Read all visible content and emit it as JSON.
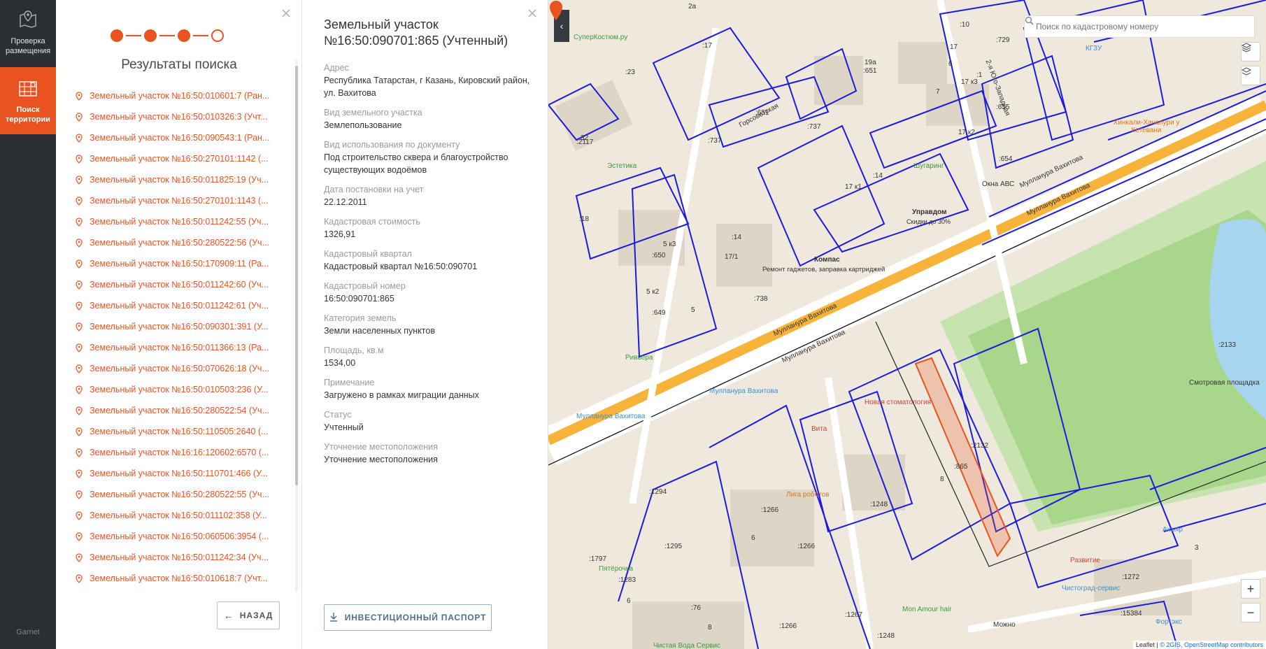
{
  "nav": {
    "items": [
      {
        "label": "Проверка размещения",
        "icon": "map-pin-icon"
      },
      {
        "label": "Поиск территории",
        "icon": "map-grid-icon"
      }
    ],
    "footer": "Garnet"
  },
  "results": {
    "title": "Результаты поиска",
    "steps": {
      "total": 4,
      "completed": 3
    },
    "items": [
      "Земельный участок №16:50:010601:7 (Ран...",
      "Земельный участок №16:50:010326:3 (Учт...",
      "Земельный участок №16:50:090543:1 (Ран...",
      "Земельный участок №16:50:270101:1142 (...",
      "Земельный участок №16:50:011825:19 (Уч...",
      "Земельный участок №16:50:270101:1143 (...",
      "Земельный участок №16:50:011242:55 (Уч...",
      "Земельный участок №16:50:280522:56 (Уч...",
      "Земельный участок №16:50:170909:11 (Ра...",
      "Земельный участок №16:50:011242:60 (Уч...",
      "Земельный участок №16:50:011242:61 (Уч...",
      "Земельный участок №16:50:090301:391 (У...",
      "Земельный участок №16:50:011366:13 (Ра...",
      "Земельный участок №16:50:070626:18 (Уч...",
      "Земельный участок №16:50:010503:236 (У...",
      "Земельный участок №16:50:280522:54 (Уч...",
      "Земельный участок №16:50:110505:2640 (...",
      "Земельный участок №16:16:120602:6570 (...",
      "Земельный участок №16:50:110701:466 (У...",
      "Земельный участок №16:50:280522:55 (Уч...",
      "Земельный участок №16:50:011102:358 (У...",
      "Земельный участок №16:50:060506:3954 (...",
      "Земельный участок №16:50:011242:34 (Уч...",
      "Земельный участок №16:50:010618:7 (Учт..."
    ],
    "back_label": "НАЗАД"
  },
  "details": {
    "title": "Земельный участок №16:50:090701:865 (Учтенный)",
    "fields": [
      {
        "label": "Адрес",
        "value": "Республика Татарстан, г Казань, Кировский район, ул. Вахитова"
      },
      {
        "label": "Вид земельного участка",
        "value": "Землепользование"
      },
      {
        "label": "Вид использования по документу",
        "value": "Под строительство сквера и благоустройство существующих водоёмов"
      },
      {
        "label": "Дата постановки на учет",
        "value": "22.12.2011"
      },
      {
        "label": "Кадастровая стоимость",
        "value": "1326,91"
      },
      {
        "label": "Кадастровый квартал",
        "value": "Кадастровый квартал №16:50:090701"
      },
      {
        "label": "Кадастровый номер",
        "value": "16:50:090701:865"
      },
      {
        "label": "Категория земель",
        "value": "Земли населенных пунктов"
      },
      {
        "label": "Площадь, кв.м",
        "value": "1534,00"
      },
      {
        "label": "Примечание",
        "value": "Загружено в рамках миграции данных"
      },
      {
        "label": "Статус",
        "value": "Учтенный"
      },
      {
        "label": "Уточнение местоположения",
        "value": "Уточнение местоположения"
      }
    ],
    "passport_label": "ИНВЕСТИЦИОННЫЙ ПАСПОРТ"
  },
  "map": {
    "search_placeholder": "Поиск по кадастровому номеру",
    "zoom_in": "+",
    "zoom_out": "−",
    "attribution_prefix": "Leaflet |",
    "attribution_main": "© 2GIS, OpenStreetMap contributors",
    "labels": {
      "suitcostume": "СуперКостюм.ру",
      "kgzu": "КГЗУ",
      "gorsovetskaya": "Горсоветская",
      "yugozapadnaya": "2-я Юго-Западная",
      "khinkali": "Хинкали-Хачапури у Кетевани",
      "estetika": "Эстетика",
      "shugaring": "Шугаринг",
      "oknaabc": "Окна АВС",
      "upravdom": "Управдом",
      "upravdom_sub": "Скидки до 30%",
      "kompas": "Компас",
      "kompas_sub": "Ремонт гаджетов, заправка картриджей",
      "vakhitova1": "Мулланура Вахитова",
      "vakhitova2": "Мулланура Вахитова",
      "vakhitova3": "Мулланура Вахитова",
      "vakhitova4": "Мулланура Вахитова",
      "vakhitova_stop1": "Мулланура Вахитова",
      "vakhitova_stop2": "Мулланура Вахитова",
      "riviera": "Ривьера",
      "stomatologia": "Новая стоматология",
      "vita": "Вита",
      "liga": "Лига роботов",
      "pyaterochka": "Пятёрочка",
      "chistaya": "Чистая Вода Сервис",
      "monamour": "Mon Amour hair",
      "mozhno": "Можно",
      "razvitie": "Развитие",
      "chistograd": "Чистоград-сервис",
      "akhyar": "Ахъяр",
      "forteks": "Фортэкс",
      "smotrovaya": "Смотровая площадка",
      "l2133": ":2133",
      "l865": ":865",
      "l2132": ":2132",
      "l1294": ":1294",
      "l1266a": ":1266",
      "l1266b": ":1266",
      "l1266c": ":1266",
      "l1248a": ":1248",
      "l1248b": ":1248",
      "l1295": ":1295",
      "l1797": ":1797",
      "l1283": ":1283",
      "l1267": ":1267",
      "l1272": ":1272",
      "l15384": ":15384",
      "l650": ":650",
      "l649": ":649",
      "l738": ":738",
      "l737a": ":737",
      "l737b": ":737",
      "l651a": ":651",
      "l651b": ":651",
      "l655": ":655",
      "l654": ":654",
      "l729": ":729",
      "l14a": ":14",
      "l14b": ":14",
      "l17": ":17",
      "l2117": ":2117",
      "l23": ":23",
      "l18": ":18",
      "l76": ":76",
      "l17k1": "17 к1",
      "l17k2": "17 к2",
      "l17k3": "17 к3",
      "l171": "17/1",
      "l5k3": "5 к3",
      "l5k2": "5 к2",
      "l19a": "19а",
      "l5": "5",
      "l6a": "6",
      "l6b": "6",
      "l8a": "8",
      "l8b": "8",
      "l3": "3",
      "l6c": "6",
      "l7": "7",
      "l17b": "17",
      "l32": "32",
      "l2a": "2а",
      "l1": ":1",
      "l10": ":10"
    }
  }
}
